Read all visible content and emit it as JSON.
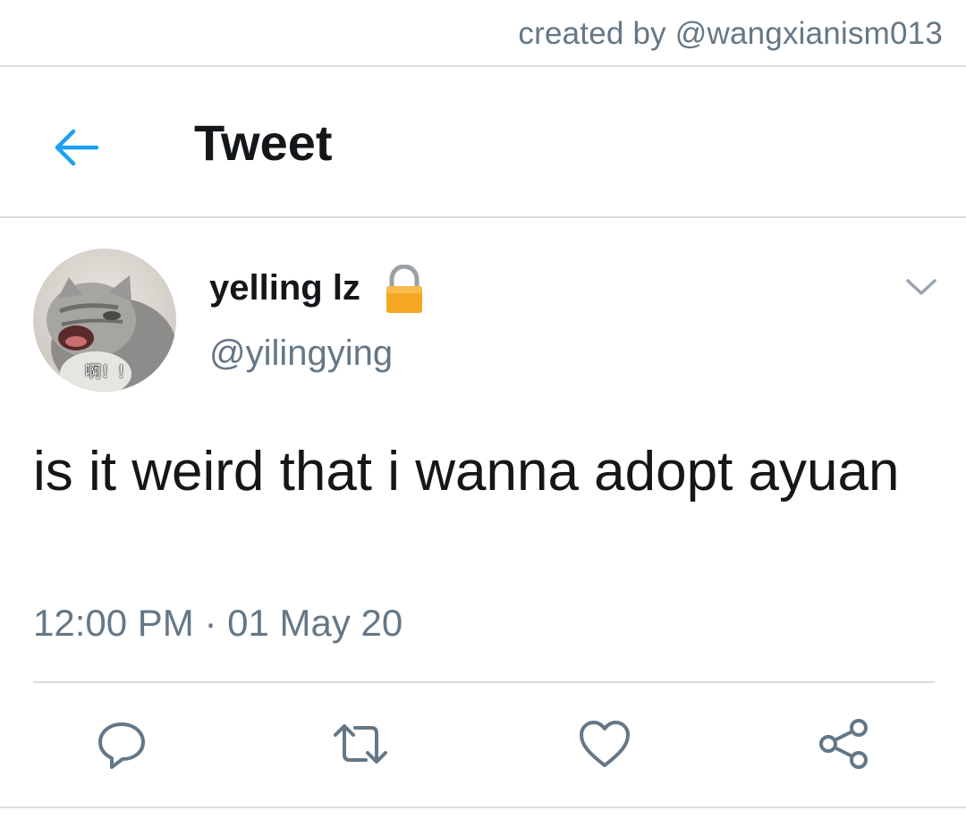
{
  "credit": "created by @wangxianism013",
  "header": {
    "title": "Tweet",
    "back_icon": "arrow-left-icon"
  },
  "tweet": {
    "display_name": "yelling lz",
    "handle": "@yilingying",
    "text": "is it weird that i wanna adopt ayuan",
    "timestamp": "12:00 PM · 01 May 20",
    "avatar_caption": "啊！！",
    "protected_icon": "lock-icon"
  },
  "actions": [
    {
      "name": "reply-icon"
    },
    {
      "name": "retweet-icon"
    },
    {
      "name": "like-icon"
    },
    {
      "name": "share-icon"
    }
  ],
  "colors": {
    "accent": "#1da1f2",
    "text_primary": "#14171a",
    "text_secondary": "#657786",
    "divider": "#d8dde1",
    "lock": "#f5a623"
  }
}
